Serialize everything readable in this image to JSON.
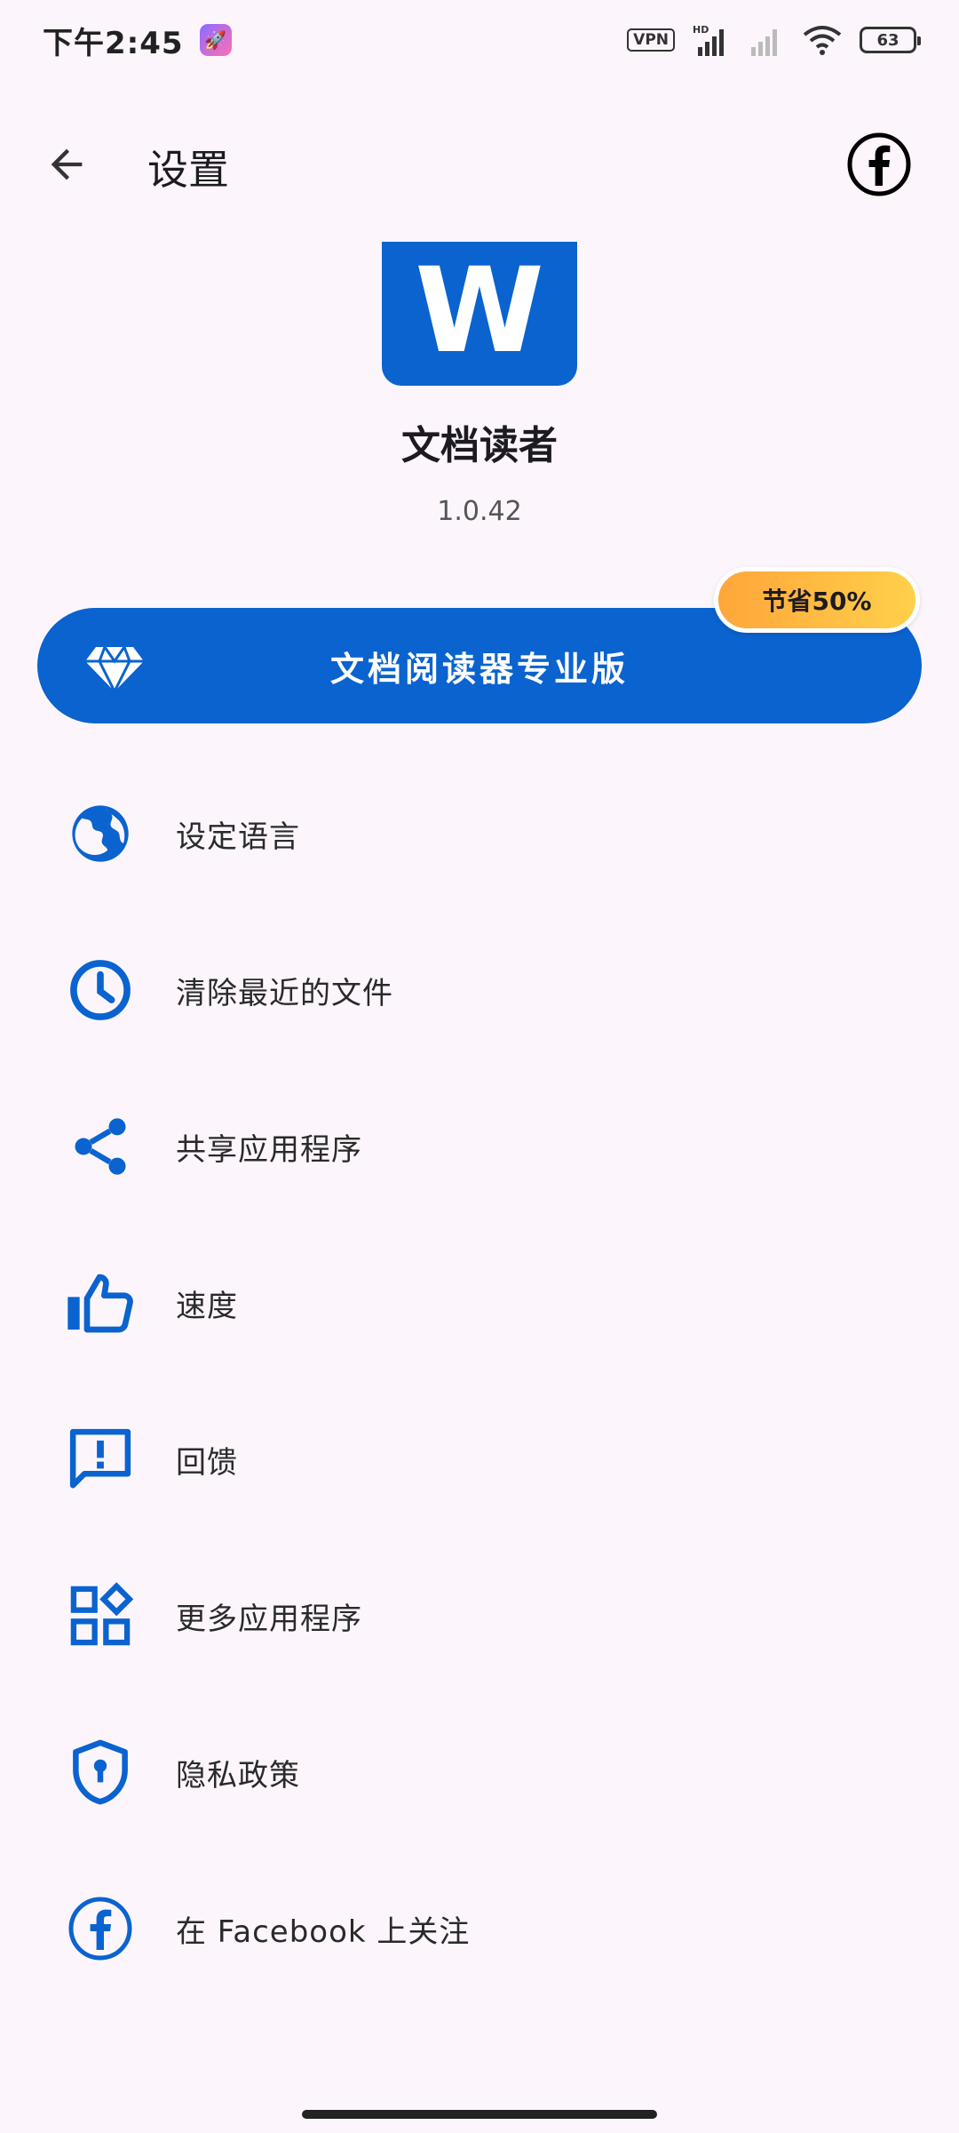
{
  "status_bar": {
    "time": "下午2:45",
    "vpn": "VPN",
    "network": "HD",
    "battery": "63"
  },
  "app_bar": {
    "title": "设置"
  },
  "app_info": {
    "name": "文档读者",
    "version": "1.0.42",
    "logo_letter": "W"
  },
  "pro": {
    "label": "文档阅读器专业版",
    "badge": "节省50%"
  },
  "menu": [
    {
      "label": "设定语言",
      "icon": "globe-icon"
    },
    {
      "label": "清除最近的文件",
      "icon": "clock-icon"
    },
    {
      "label": "共享应用程序",
      "icon": "share-icon"
    },
    {
      "label": "速度",
      "icon": "thumbs-up-icon"
    },
    {
      "label": "回馈",
      "icon": "feedback-icon"
    },
    {
      "label": "更多应用程序",
      "icon": "apps-icon"
    },
    {
      "label": "隐私政策",
      "icon": "shield-icon"
    },
    {
      "label": "在 Facebook 上关注",
      "icon": "facebook-icon"
    }
  ],
  "colors": {
    "accent": "#0A63CF",
    "background": "#FCF6FC",
    "badge_start": "#FFA63A",
    "badge_end": "#FFD04A"
  }
}
